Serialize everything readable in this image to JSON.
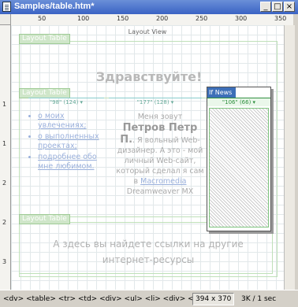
{
  "window": {
    "title": "Samples/table.htm*"
  },
  "ruler_top": [
    "50",
    "100",
    "150",
    "200",
    "250",
    "300",
    "350"
  ],
  "ruler_left": [
    "1",
    "1",
    "2",
    "2",
    "3"
  ],
  "layout": {
    "view_label": "Layout View",
    "table_tab": "Layout Table",
    "table_tab2": "Layout Table",
    "table_tab3": "Layout Table",
    "greeting": "Здравствуйте!",
    "col1_width": "\"98\" (124) ▾",
    "col2_width": "\"177\" (128) ▾"
  },
  "links": [
    "о моих увлечениях;",
    "о выполненных проектах;",
    "подробнее обо мне любимом."
  ],
  "intro": {
    "line1": "Меня зовут",
    "name": "Петров Петр П.",
    "rest": ". Я вольный Web-дизайнер. А это - мой личный Web-сайт, который сделал я сам в ",
    "mm": "Macromedia",
    "tail": " Dreamweaver MX"
  },
  "ifnews": {
    "title": "If News",
    "width": "\"106\" (66) ▾"
  },
  "bottom_text": "А здесь вы найдете ссылки на другие интернет-ресурсы",
  "status": {
    "tags": "<dv> <table> <tr> <td> <div> <ul> <li> <div> <font> <a>",
    "size": "394 x 370",
    "download": "3K / 1 sec"
  }
}
